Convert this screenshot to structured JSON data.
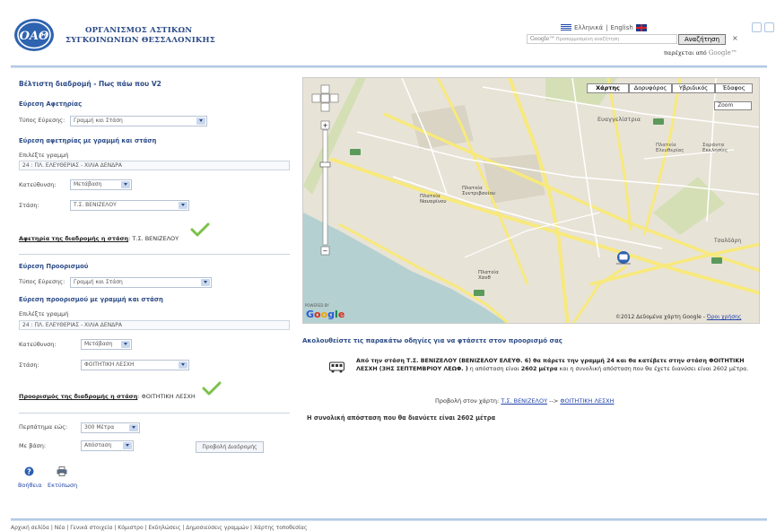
{
  "header": {
    "org_line1": "ΟΡΓΑΝΙΣΜΟΣ ΑΣΤΙΚΩΝ",
    "org_line2": "ΣΥΓΚΟΙΝΩΝΙΩΝ ΘΕΣΣΑΛΟΝΙΚΗΣ",
    "lang_greek": "Ελληνικά",
    "lang_sep": "|",
    "lang_english": "English",
    "search_brand": "Google™",
    "search_placeholder": "Προσαρμοσμένη αναζήτηση",
    "search_button": "Αναζήτηση",
    "clear_button": "×",
    "powered_label": "παρέχεται από",
    "powered_brand": "Google™"
  },
  "page_title": "Βέλτιστη διαδρομή - Πως πάω που V2",
  "start": {
    "section": "Εύρεση Αφετηρίας",
    "type_label": "Τύπος Εύρεσης:",
    "type_value": "Γραμμή και Στάση",
    "sub_section": "Εύρεση αφετηρίας με γραμμή και στάση",
    "line_label": "Επιλέξτε γραμμή",
    "line_value": "24 : ΠΛ. ΕΛΕΥΘΕΡΙΑΣ - ΧΙΛΙΑ ΔΕΝΔΡΑ",
    "direction_label": "Κατεύθυνση:",
    "direction_value": "Μετάβαση",
    "stop_label": "Στάση:",
    "stop_value": "Τ.Σ. ΒΕΝΙΖΕΛΟΥ",
    "confirm_label": "Αφετηρία της διαδρομής η στάση",
    "confirm_value": ": Τ.Σ. ΒΕΝΙΖΕΛΟΥ"
  },
  "dest": {
    "section": "Εύρεση Προορισμού",
    "type_label": "Τύπος Εύρεσης:",
    "type_value": "Γραμμή και Στάση",
    "sub_section": "Εύρεση προορισμού με γραμμή και στάση",
    "line_label": "Επιλέξτε γραμμή",
    "line_value": "24 : ΠΛ. ΕΛΕΥΘΕΡΙΑΣ - ΧΙΛΙΑ ΔΕΝΔΡΑ",
    "direction_label": "Κατεύθυνση:",
    "direction_value": "Μετάβαση",
    "stop_label": "Στάση:",
    "stop_value": "ΦΟΙΤΗΤΙΚΗ ΛΕΣΧΗ",
    "confirm_label": "Προορισμός της διαδρομής η στάση",
    "confirm_value": ": ΦΟΙΤΗΤΙΚΗ ΛΕΣΧΗ"
  },
  "options": {
    "walk_label": "Περπάτημα εώς:",
    "walk_value": "300 Μέτρα",
    "basis_label": "Με βάση:",
    "basis_value": "Απόσταση",
    "show_route_button": "Προβολή Διαδρομής",
    "help_label": "Βοήθεια",
    "print_label": "Εκτύπωση"
  },
  "map": {
    "tabs": [
      "Χάρτης",
      "Δορυφόρος",
      "Υβριδικός",
      "Έδαφος"
    ],
    "zoom_label": "Zoom",
    "powered_small": "POWERED BY",
    "logo": "Google",
    "copyright": "©2012 Δεδομένα χάρτη Google -",
    "terms": "Όροι χρήσης",
    "places": [
      {
        "name": "Ευαγγελίστρια"
      },
      {
        "name": "Πλατεία Ελευθερίας"
      },
      {
        "name": "Σαράντα Εκκλησίες"
      },
      {
        "name": "Πλατεία Ναυαρίνου"
      },
      {
        "name": "Πλατεία Συντριβανίου"
      },
      {
        "name": "Τσαλδάρη"
      },
      {
        "name": "Πλατεία Χανθ"
      }
    ]
  },
  "directions": {
    "heading": "Ακολουθείστε τις παρακάτω οδηγίες για να φτάσετε στον προορισμό σας",
    "step_bold": "Από την στάση Τ.Σ. ΒΕΝΙΖΕΛΟΥ (ΒΕΝΙΖΕΛΟΥ ΕΛΕΥΘ. 6) θα πάρετε την γραμμή 24 και θα κατέβετε στην στάση ΦΟΙΤΗΤΙΚΗ ΛΕΣΧΗ (3ΗΣ ΣΕΠΤΕΜΒΡΙΟΥ ΛΕΩΦ. )",
    "step_rest_1": " η απόσταση είναι ",
    "step_dist": "2602 μέτρα",
    "step_rest_2": " και η συνολική απόσταση που θα έχετε διανύσει είναι 2602 μέτρα.",
    "view_prefix": "Προβολή στον χάρτη:",
    "view_from": "Τ.Σ. ΒΕΝΙΖΕΛΟΥ",
    "view_arrow": "-->",
    "view_to": "ΦΟΙΤΗΤΙΚΗ ΛΕΣΧΗ",
    "total": "Η συνολική απόσταση που θα διανύετε είναι 2602 μέτρα"
  },
  "footer": "Αρχική σελίδα | Νέα | Γενικά στοιχεία | Κόμιστρο | Εκδηλώσεις | Δημοσιεύσεις γραμμών | Χάρτης τοποθεσίας"
}
